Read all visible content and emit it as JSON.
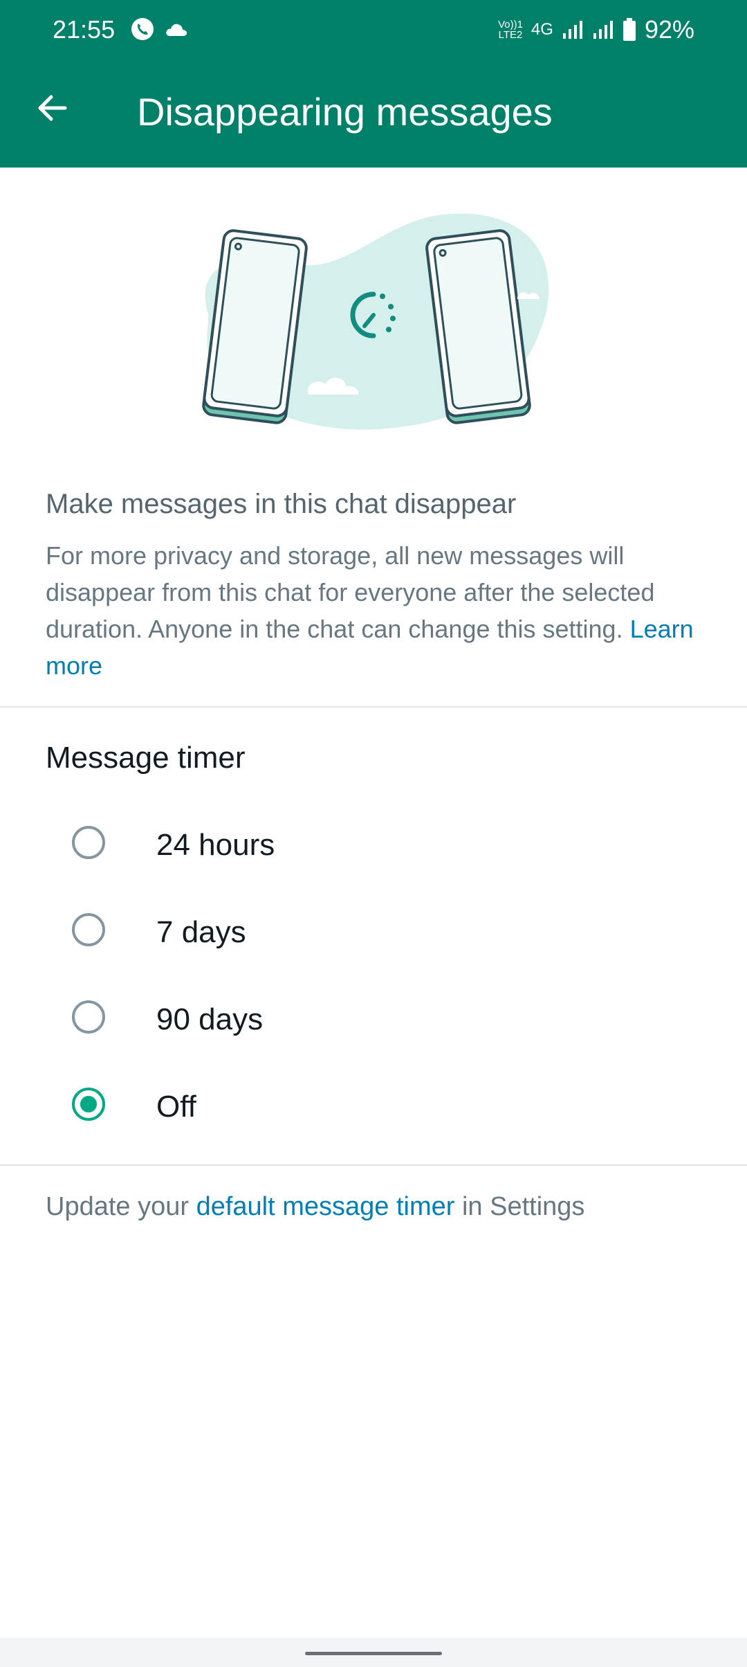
{
  "status_bar": {
    "time": "21:55",
    "left_icons": [
      "call-icon",
      "cloud-icon"
    ],
    "network_label_top": "Vo))1",
    "network_label_bottom": "LTE2",
    "network_type": "4G",
    "battery_percent": "92%"
  },
  "header": {
    "title": "Disappearing messages",
    "back_icon": "arrow-left-icon"
  },
  "intro": {
    "heading": "Make messages in this chat disappear",
    "description": "For more privacy and storage, all new messages will disappear from this chat for everyone after the selected duration. Anyone in the chat can change this setting.",
    "learn_more": "Learn more"
  },
  "timer": {
    "label": "Message timer",
    "options": [
      {
        "label": "24 hours",
        "selected": false
      },
      {
        "label": "7 days",
        "selected": false
      },
      {
        "label": "90 days",
        "selected": false
      },
      {
        "label": "Off",
        "selected": true
      }
    ]
  },
  "footer": {
    "prefix": "Update your",
    "link": "default message timer",
    "suffix": "in Settings"
  },
  "colors": {
    "brand_header": "#008069",
    "accent": "#00a884",
    "link": "#027eb5"
  }
}
